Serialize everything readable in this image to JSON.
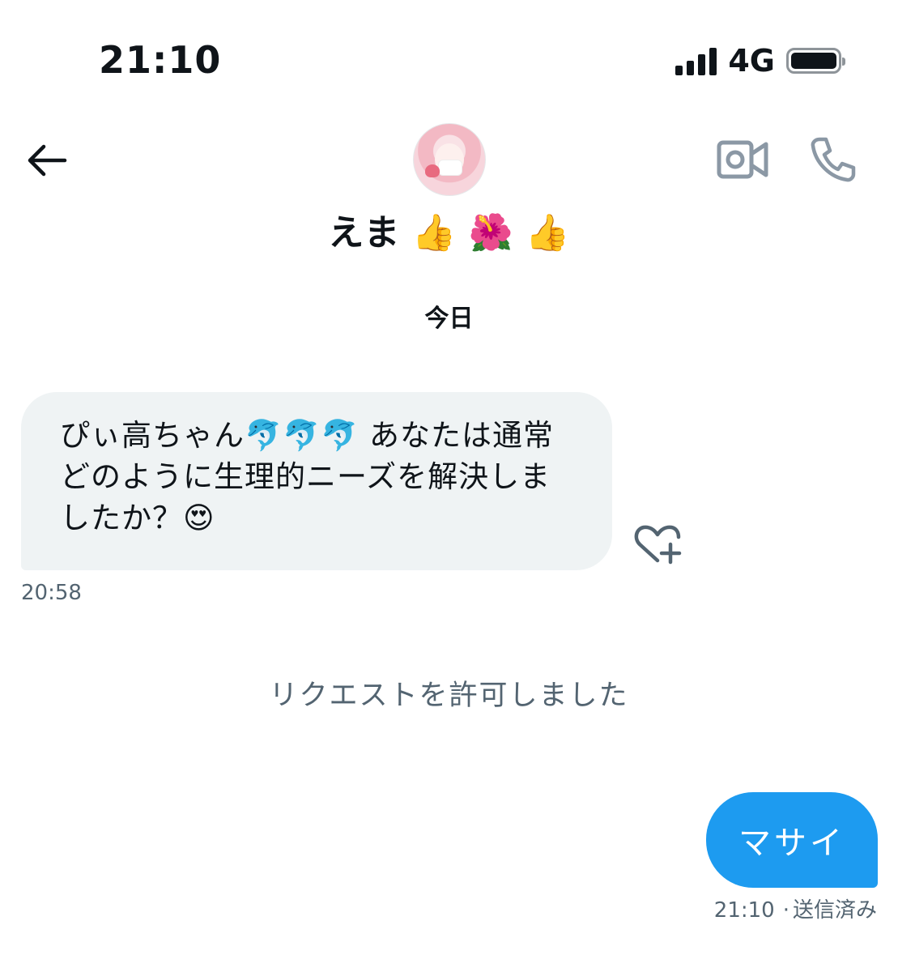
{
  "status_bar": {
    "time": "21:10",
    "network": "4G",
    "signal_icon": "signal-bars-icon",
    "battery_icon": "battery-full-icon"
  },
  "header": {
    "contact_name": "えま 👍 🌺 👍",
    "icons": {
      "back": "back-arrow-icon",
      "video": "video-camera-icon",
      "call": "phone-icon"
    }
  },
  "conversation": {
    "date_separator": "今日",
    "received": {
      "text": "ぴぃ高ちゃん🐬🐬🐬 あなたは通常どのように生理的ニーズを解決しましたか？😍",
      "time": "20:58",
      "reaction_icon": "heart-plus-icon"
    },
    "system_message": "リクエストを許可しました",
    "sent": {
      "text": "マサイ",
      "time": "21:10",
      "status": "送信済み"
    }
  },
  "colors": {
    "accent": "#1d9bf0",
    "bubble_in": "#eff3f4",
    "muted_text": "#536471",
    "icon_gray": "#8b98a5"
  }
}
